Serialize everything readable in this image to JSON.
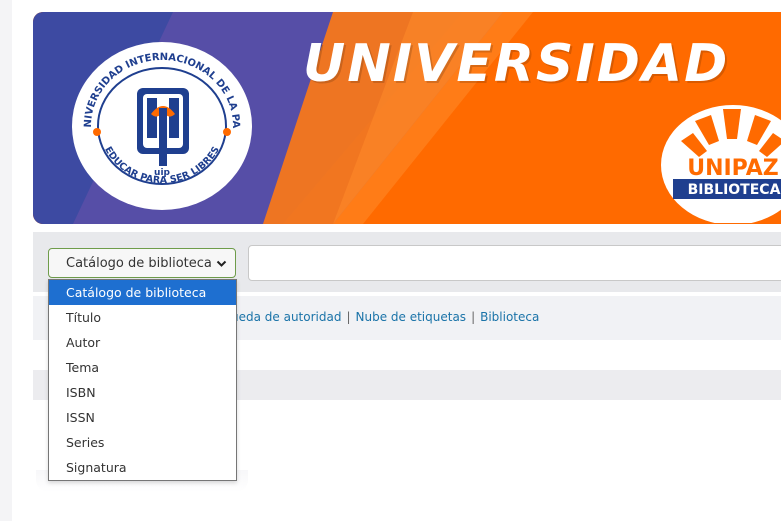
{
  "banner": {
    "title": "UNIVERSIDAD",
    "seal_text_top": "UNIVERSIDAD INTERNACIONAL DE LA PAZ",
    "seal_text_bottom": "EDUCAR PARA SER LIBRES",
    "seal_mark": "uip",
    "library_logo_name": "UNIPAZ",
    "library_logo_sub": "BIBLIOTECA",
    "colors": {
      "orange": "#ff6a00",
      "blue": "#1f3f8f",
      "purple": "#5a4fa8"
    }
  },
  "search": {
    "select_value": "Catálogo de biblioteca",
    "input_value": "",
    "options": [
      "Catálogo de biblioteca",
      "Título",
      "Autor",
      "Tema",
      "ISBN",
      "ISSN",
      "Series",
      "Signatura"
    ],
    "selected_index": 0
  },
  "nav_links": {
    "authority_search": "ueda de autoridad",
    "tag_cloud": "Nube de etiquetas",
    "libraries": "Biblioteca",
    "separator": "|"
  }
}
